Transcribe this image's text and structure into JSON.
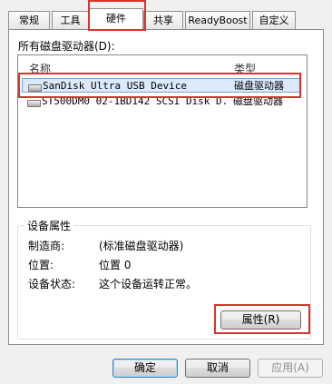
{
  "tabs": [
    {
      "label": "常规"
    },
    {
      "label": "工具"
    },
    {
      "label": "硬件"
    },
    {
      "label": "共享"
    },
    {
      "label": "ReadyBoost"
    },
    {
      "label": "自定义"
    }
  ],
  "active_tab": "硬件",
  "section_label": "所有磁盘驱动器(D):",
  "list": {
    "columns": {
      "name": "名称",
      "type": "类型"
    },
    "rows": [
      {
        "name": "SanDisk Ultra USB Device",
        "type": "磁盘驱动器",
        "selected": true
      },
      {
        "name": "ST500DM0 02-1BD142 SCSI Disk D...",
        "type": "磁盘驱动器",
        "selected": false
      }
    ]
  },
  "properties": {
    "title": "设备属性",
    "manufacturer_label": "制造商:",
    "manufacturer_value": "(标准磁盘驱动器)",
    "location_label": "位置:",
    "location_value": "位置 0",
    "status_label": "设备状态:",
    "status_value": "这个设备运转正常。",
    "properties_button": "属性(R)"
  },
  "buttons": {
    "ok": "确定",
    "cancel": "取消",
    "apply": "应用(A)"
  },
  "colors": {
    "highlight": "#d9342b",
    "selection": "#dcebfc"
  }
}
